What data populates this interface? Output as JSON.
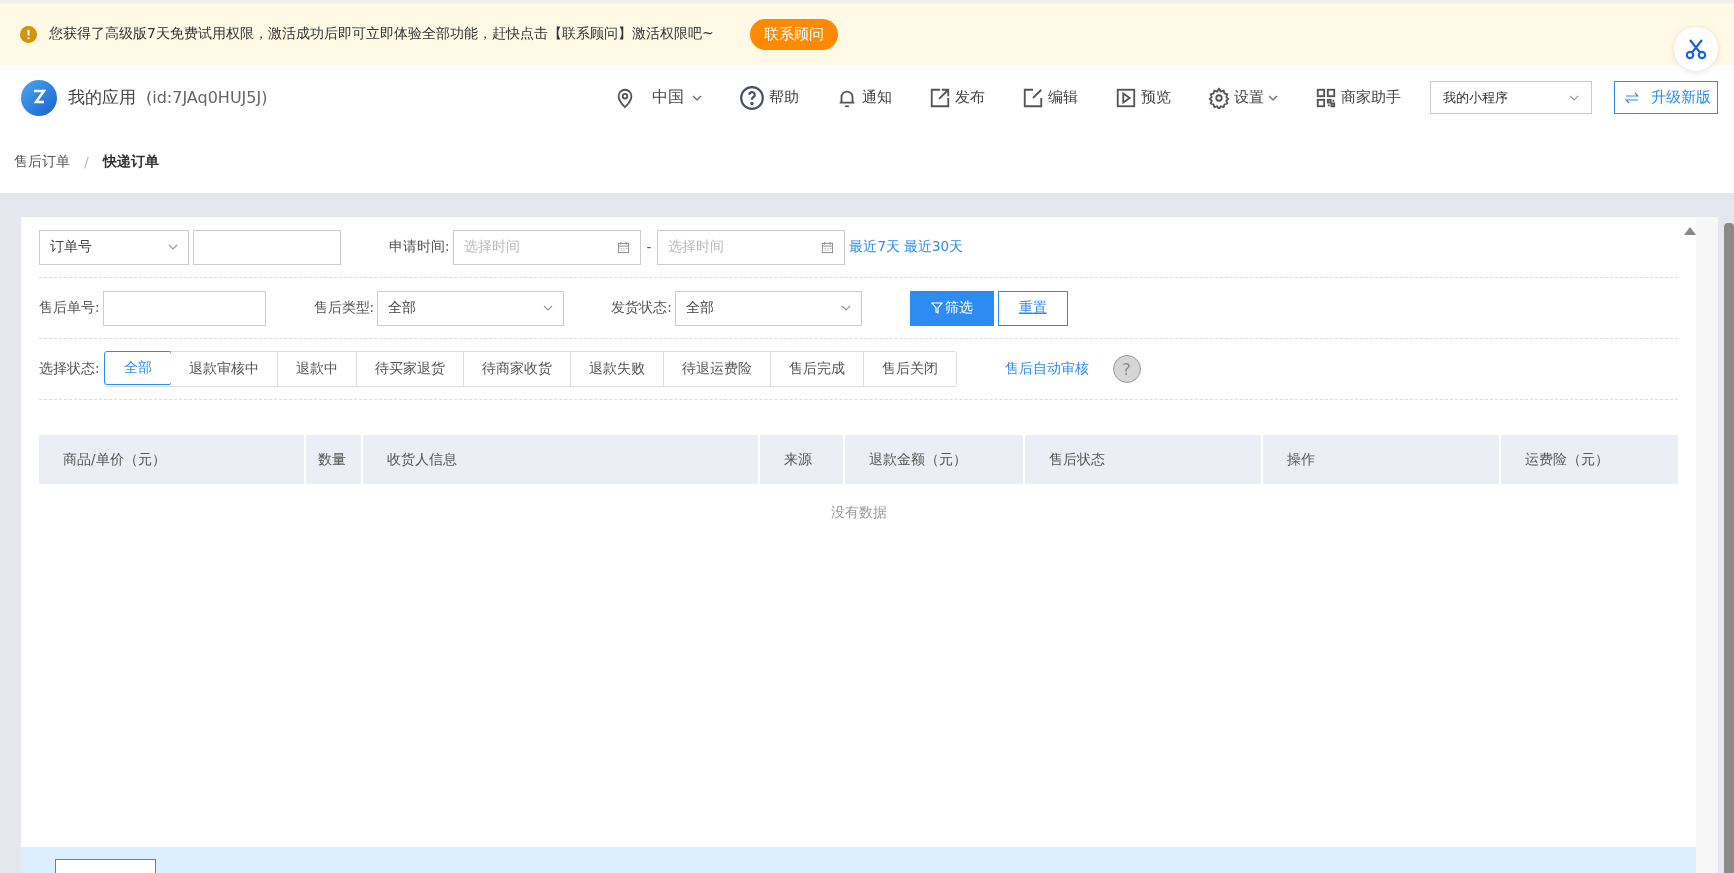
{
  "banner": {
    "message": "您获得了高级版7天免费试用权限，激活成功后即可立即体验全部功能，赶快点击【联系顾问】激活权限吧~",
    "button": "联系顾问"
  },
  "header": {
    "app_name": "我的应用",
    "app_id": "(id:7JAq0HUJ5J)",
    "nav": [
      {
        "kind": "location",
        "label": "中国",
        "dropdown": true
      },
      {
        "kind": "help",
        "label": "帮助",
        "dropdown": false
      },
      {
        "kind": "bell",
        "label": "通知",
        "dropdown": false
      },
      {
        "kind": "share",
        "label": "发布",
        "dropdown": false
      },
      {
        "kind": "edit",
        "label": "编辑",
        "dropdown": false
      },
      {
        "kind": "play",
        "label": "预览",
        "dropdown": false
      },
      {
        "kind": "gear",
        "label": "设置",
        "dropdown": true
      },
      {
        "kind": "qr",
        "label": "商家助手",
        "dropdown": false
      }
    ],
    "app_select": "我的小程序",
    "upgrade_button": "升级新版"
  },
  "breadcrumb": {
    "separator": "/",
    "items": [
      {
        "label": "售后订单",
        "current": false
      },
      {
        "label": "快递订单",
        "current": true
      }
    ]
  },
  "filters": {
    "order_field": "订单号",
    "date_label": "申请时间:",
    "date_from_placeholder": "选择时间",
    "date_separator": "-",
    "date_to_placeholder": "选择时间",
    "quick_ranges": [
      "最近7天",
      "最近30天"
    ],
    "after_sale_no_label": "售后单号:",
    "type_label": "售后类型:",
    "type_value": "全部",
    "ship_label": "发货状态:",
    "ship_value": "全部",
    "filter_button": "筛选",
    "reset_button": "重置",
    "status_label": "选择状态:"
  },
  "status_tabs": [
    {
      "label": "全部",
      "selected": true
    },
    {
      "label": "退款审核中",
      "selected": false
    },
    {
      "label": "退款中",
      "selected": false
    },
    {
      "label": "待买家退货",
      "selected": false
    },
    {
      "label": "待商家收货",
      "selected": false
    },
    {
      "label": "退款失败",
      "selected": false
    },
    {
      "label": "待退运费险",
      "selected": false
    },
    {
      "label": "售后完成",
      "selected": false
    },
    {
      "label": "售后关闭",
      "selected": false
    }
  ],
  "auto_review_link": "售后自动审核",
  "help_mark": "?",
  "table": {
    "columns": [
      "商品/单价（元）",
      "数量",
      "收货人信息",
      "来源",
      "退款金额（元）",
      "售后状态",
      "操作",
      "运费险（元）"
    ],
    "empty_text": "没有数据"
  }
}
